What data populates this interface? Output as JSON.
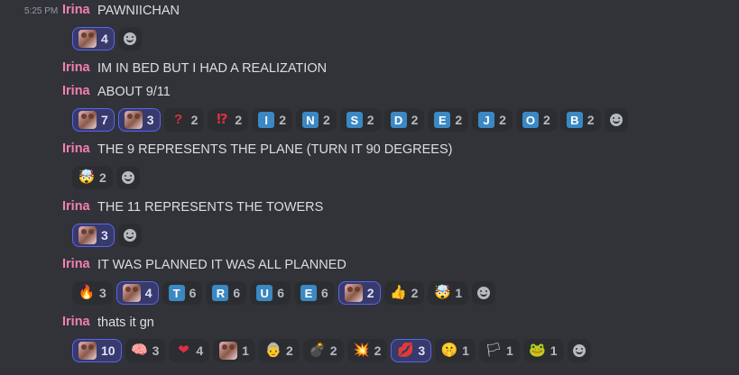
{
  "author": "Irina",
  "timestamp": "5:25 PM",
  "messages": [
    {
      "text": "PAWNIICHAN",
      "reactions": [
        {
          "emoji": "bear-custom-emoji",
          "count": "4",
          "me": true
        }
      ]
    },
    {
      "text": "IM IN BED BUT I HAD A REALIZATION",
      "reactions": []
    },
    {
      "text": "ABOUT 9/11",
      "reactions": [
        {
          "emoji": "bear-custom-emoji",
          "count": "7",
          "me": true
        },
        {
          "emoji": "bear-custom-emoji-2",
          "count": "3",
          "me": true
        },
        {
          "emoji": "question",
          "glyph": "?",
          "count": "2"
        },
        {
          "emoji": "interrobang",
          "glyph": "⁉",
          "count": "2"
        },
        {
          "emoji": "regional-i",
          "letter": "I",
          "count": "2"
        },
        {
          "emoji": "regional-n",
          "letter": "N",
          "count": "2"
        },
        {
          "emoji": "regional-s",
          "letter": "S",
          "count": "2"
        },
        {
          "emoji": "regional-d",
          "letter": "D",
          "count": "2"
        },
        {
          "emoji": "regional-e",
          "letter": "E",
          "count": "2"
        },
        {
          "emoji": "regional-j",
          "letter": "J",
          "count": "2"
        },
        {
          "emoji": "regional-o",
          "letter": "O",
          "count": "2"
        },
        {
          "emoji": "regional-b",
          "letter": "B",
          "count": "2"
        }
      ]
    },
    {
      "text": "THE 9 REPRESENTS THE PLANE (TURN IT 90 DEGREES)",
      "reactions": [
        {
          "emoji": "exploding-head",
          "glyph": "🤯",
          "count": "2"
        }
      ]
    },
    {
      "text": "THE 11 REPRESENTS THE TOWERS",
      "reactions": [
        {
          "emoji": "bear-custom-emoji",
          "count": "3",
          "me": true
        }
      ]
    },
    {
      "text": "IT WAS PLANNED IT WAS ALL PLANNED",
      "reactions": [
        {
          "emoji": "fire",
          "glyph": "🔥",
          "count": "3"
        },
        {
          "emoji": "bear-custom-emoji",
          "count": "4",
          "me": true
        },
        {
          "emoji": "regional-t",
          "letter": "T",
          "count": "6"
        },
        {
          "emoji": "regional-r",
          "letter": "R",
          "count": "6"
        },
        {
          "emoji": "regional-u",
          "letter": "U",
          "count": "6"
        },
        {
          "emoji": "regional-e",
          "letter": "E",
          "count": "6"
        },
        {
          "emoji": "bear-custom-emoji-3",
          "count": "2",
          "me": true
        },
        {
          "emoji": "thumbs-up",
          "glyph": "👍",
          "count": "2"
        },
        {
          "emoji": "exploding-head",
          "glyph": "🤯",
          "count": "1"
        }
      ]
    },
    {
      "text": "thats it gn",
      "reactions": [
        {
          "emoji": "bear-custom-emoji",
          "count": "10",
          "me": true
        },
        {
          "emoji": "brain",
          "glyph": "🧠",
          "count": "3"
        },
        {
          "emoji": "heart",
          "glyph": "❤",
          "count": "4"
        },
        {
          "emoji": "pink-custom-emoji",
          "count": "1"
        },
        {
          "emoji": "old-person",
          "glyph": "👵",
          "count": "2"
        },
        {
          "emoji": "bomb",
          "glyph": "💣",
          "count": "2"
        },
        {
          "emoji": "collision",
          "glyph": "💥",
          "count": "2"
        },
        {
          "emoji": "kiss-lips",
          "glyph": "💋",
          "count": "3",
          "me": true
        },
        {
          "emoji": "hushed-face",
          "glyph": "🤫",
          "count": "1"
        },
        {
          "emoji": "rainbow-flag",
          "glyph": "🏳",
          "count": "1"
        },
        {
          "emoji": "frog",
          "glyph": "🐸",
          "count": "1"
        }
      ]
    }
  ],
  "add_reaction_label": "add-reaction",
  "colors": {
    "background": "#313338",
    "author": "#f47fb0",
    "reaction_me_border": "#5865f2",
    "letter_blue": "#3b88c3"
  }
}
